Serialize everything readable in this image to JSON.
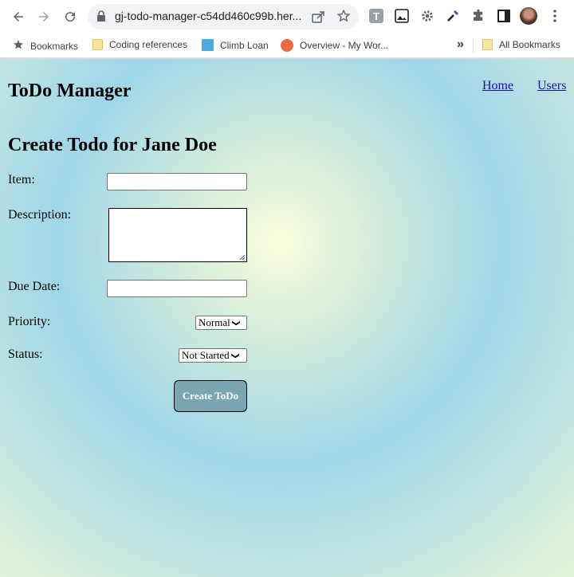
{
  "browser": {
    "url": "gj-todo-manager-c54dd460c99b.her...",
    "bookmarks": [
      {
        "label": "Bookmarks",
        "icon": "star-icon"
      },
      {
        "label": "Coding references",
        "icon": "folder-icon"
      },
      {
        "label": "Climb Loan",
        "icon": "bookmark-favicon"
      },
      {
        "label": "Overview - My Wor...",
        "icon": "bookmark-favicon"
      }
    ],
    "overflow_label": "»",
    "all_bookmarks_label": "All Bookmarks"
  },
  "site": {
    "title": "ToDo Manager",
    "nav": [
      {
        "label": "Home"
      },
      {
        "label": "Users"
      }
    ]
  },
  "form": {
    "title": "Create Todo for Jane Doe",
    "item_label": "Item:",
    "item_value": "",
    "description_label": "Description:",
    "description_value": "",
    "due_date_label": "Due Date:",
    "due_date_value": "",
    "priority_label": "Priority:",
    "priority_value": "Normal",
    "status_label": "Status:",
    "status_value": "Not Started",
    "submit_label": "Create ToDo"
  },
  "colors": {
    "button_bg": "#7aa5b2",
    "link": "#1a0dab",
    "accent_gradient_center": "#fbfddc",
    "accent_gradient_edge": "#9fd6e8"
  }
}
